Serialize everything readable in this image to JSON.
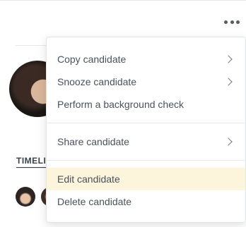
{
  "timeline": {
    "tab_label": "TIMELI"
  },
  "menu": {
    "items": [
      {
        "label": "Copy candidate",
        "has_submenu": true
      },
      {
        "label": "Snooze candidate",
        "has_submenu": true
      },
      {
        "label": "Perform a background check",
        "has_submenu": false
      },
      {
        "label": "Share candidate",
        "has_submenu": true
      },
      {
        "label": "Edit candidate",
        "has_submenu": false,
        "highlighted": true
      },
      {
        "label": "Delete candidate",
        "has_submenu": false
      }
    ]
  },
  "icons": {
    "more": "more-horizontal-icon",
    "submenu": "chevron-right-icon"
  },
  "colors": {
    "highlight": "#fdf4dc",
    "text": "#4a525a"
  }
}
